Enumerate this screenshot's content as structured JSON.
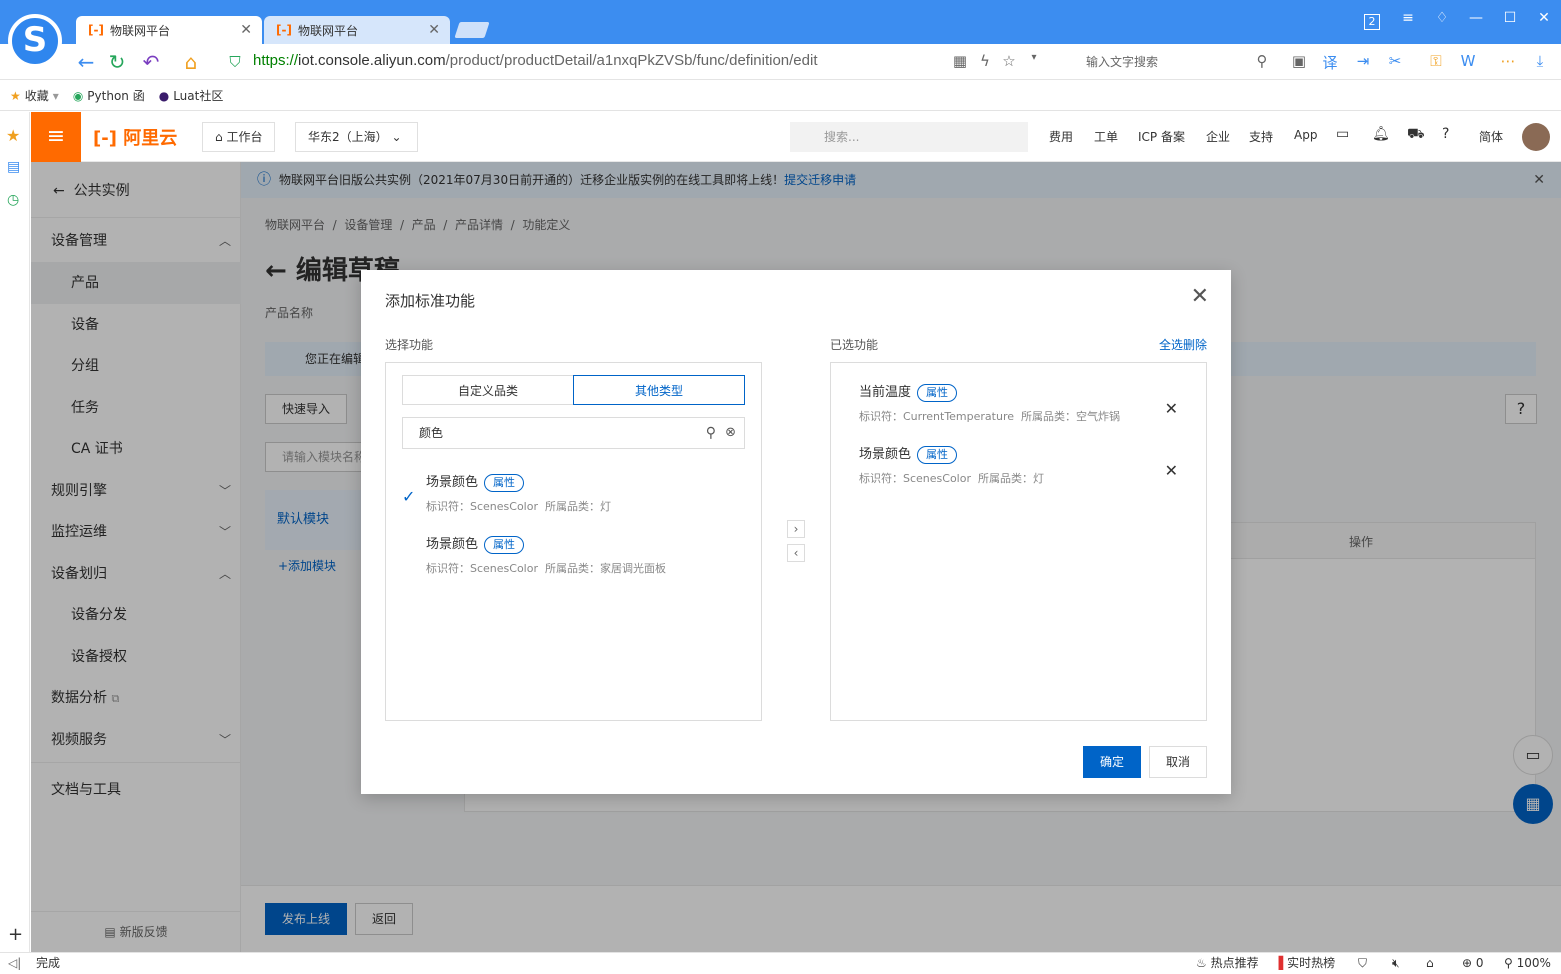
{
  "browser": {
    "tabs": [
      {
        "title": "物联网平台"
      },
      {
        "title": "物联网平台"
      }
    ],
    "url_prefix": "https://",
    "url_host": "iot.console.aliyun.com",
    "url_path": "/product/productDetail/a1nxqPkZVSb/func/definition/edit",
    "search_placeholder": "输入文字搜索",
    "window_badge": "2",
    "bookmarks": [
      "收藏",
      "Python 函",
      "Luat社区"
    ]
  },
  "console": {
    "brand": "阿里云",
    "workbench": "工作台",
    "region": "华东2（上海）",
    "search_placeholder": "搜索...",
    "nav": [
      "费用",
      "工单",
      "ICP 备案",
      "企业",
      "支持",
      "App",
      "简体"
    ]
  },
  "sidebar": {
    "back_label": "公共实例",
    "items": [
      {
        "label": "设备管理",
        "chevron": "up"
      },
      {
        "label": "产品",
        "active": true
      },
      {
        "label": "设备"
      },
      {
        "label": "分组"
      },
      {
        "label": "任务"
      },
      {
        "label": "CA 证书"
      },
      {
        "label": "规则引擎",
        "chevron": "down"
      },
      {
        "label": "监控运维",
        "chevron": "down"
      },
      {
        "label": "设备划归",
        "chevron": "up"
      },
      {
        "label": "设备分发"
      },
      {
        "label": "设备授权"
      },
      {
        "label": "数据分析"
      },
      {
        "label": "视频服务",
        "chevron": "down"
      },
      {
        "label": "文档与工具"
      }
    ],
    "feedback": "新版反馈"
  },
  "page": {
    "notice": "物联网平台旧版公共实例（2021年07月30日前开通的）迁移企业版实例的在线工具即将上线！",
    "notice_link": "提交迁移申请",
    "breadcrumb": [
      "物联网平台",
      "设备管理",
      "产品",
      "产品详情",
      "功能定义"
    ],
    "title": "编辑草稿",
    "product_name_label": "产品名称",
    "editing_notice": "您正在编辑",
    "quick_import": "快速导入",
    "module_search_placeholder": "请输入模块名称",
    "default_module": "默认模块",
    "add_module": "+添加模块",
    "col_action": "操作",
    "help": "?",
    "publish": "发布上线",
    "back": "返回"
  },
  "dialog": {
    "title": "添加标准功能",
    "select_label": "选择功能",
    "selected_label": "已选功能",
    "delete_all": "全选删除",
    "seg_custom": "自定义品类",
    "seg_other": "其他类型",
    "search_value": "颜色",
    "results": [
      {
        "name": "场景颜色",
        "tag": "属性",
        "identifier": "标识符：ScenesColor",
        "category": "所属品类：灯",
        "checked": true
      },
      {
        "name": "场景颜色",
        "tag": "属性",
        "identifier": "标识符：ScenesColor",
        "category": "所属品类：家居调光面板",
        "checked": false
      }
    ],
    "selected": [
      {
        "name": "当前温度",
        "tag": "属性",
        "identifier": "标识符：CurrentTemperature",
        "category": "所属品类：空气炸锅"
      },
      {
        "name": "场景颜色",
        "tag": "属性",
        "identifier": "标识符：ScenesColor",
        "category": "所属品类：灯"
      }
    ],
    "ok": "确定",
    "cancel": "取消"
  },
  "status": {
    "left": "完成",
    "hot": "热点推荐",
    "trend": "实时热榜",
    "downloads": "0",
    "zoom": "100%"
  }
}
